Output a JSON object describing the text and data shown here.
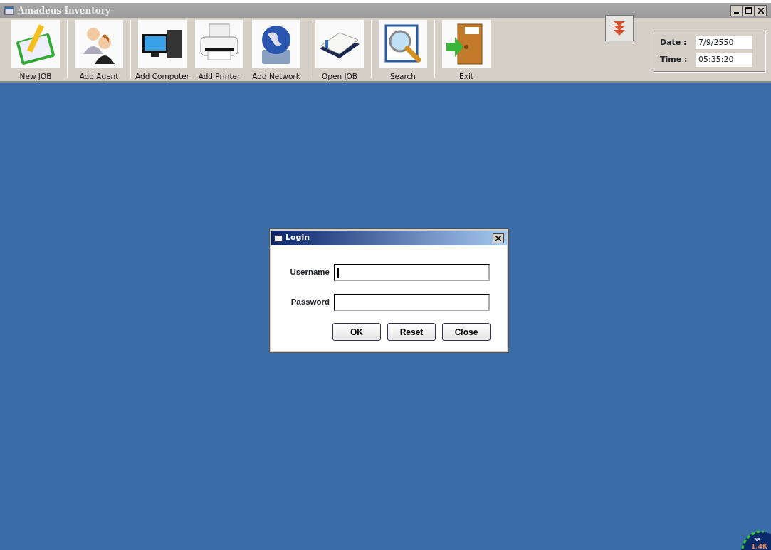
{
  "window": {
    "title": "Amadeus Inventory"
  },
  "toolbar": [
    {
      "label": "New JOB",
      "separator_after": true
    },
    {
      "label": "Add Agent",
      "separator_after": true
    },
    {
      "label": "Add Computer",
      "separator_after": false
    },
    {
      "label": "Add Printer",
      "separator_after": false
    },
    {
      "label": "Add Network",
      "separator_after": true
    },
    {
      "label": "Open JOB",
      "separator_after": true
    },
    {
      "label": "Search",
      "separator_after": true
    },
    {
      "label": "Exit",
      "separator_after": false
    }
  ],
  "datetime": [
    {
      "label": "Date :",
      "value": "7/9/2550"
    },
    {
      "label": "Time :",
      "value": "05:35:20"
    }
  ],
  "login": {
    "title": "Login",
    "fields": [
      {
        "label": "Username",
        "focused": true
      },
      {
        "label": "Password",
        "focused": false
      }
    ],
    "buttons": [
      "OK",
      "Reset",
      "Close"
    ]
  },
  "gauge": {
    "readings": [
      "58",
      "1.4K"
    ]
  }
}
